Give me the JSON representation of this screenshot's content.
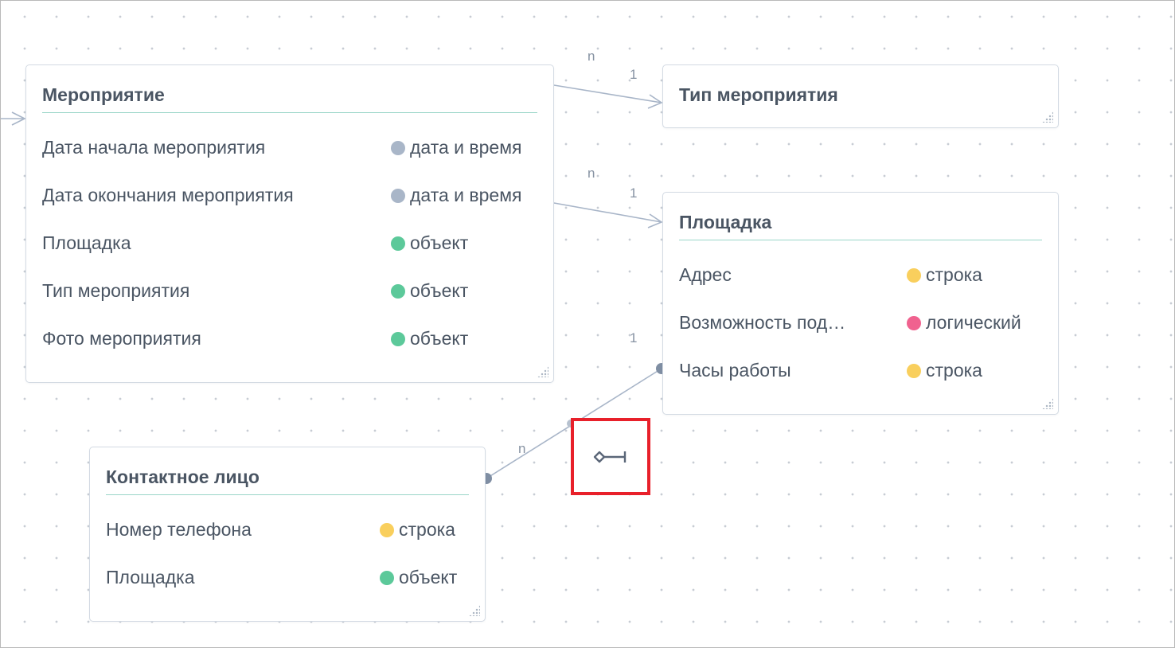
{
  "entities": {
    "event": {
      "title": "Мероприятие",
      "fields": [
        {
          "name": "Дата начала мероприятия",
          "type": "дата и время",
          "color": "#a9b6c8"
        },
        {
          "name": "Дата окончания мероприятия",
          "type": "дата и время",
          "color": "#a9b6c8"
        },
        {
          "name": "Площадка",
          "type": "объект",
          "color": "#5cc99a"
        },
        {
          "name": "Тип мероприятия",
          "type": "объект",
          "color": "#5cc99a"
        },
        {
          "name": "Фото мероприятия",
          "type": "объект",
          "color": "#5cc99a"
        }
      ]
    },
    "event_type": {
      "title": "Тип мероприятия",
      "fields": []
    },
    "venue": {
      "title": "Площадка",
      "fields": [
        {
          "name": "Адрес",
          "type": "строка",
          "color": "#f9cf5d"
        },
        {
          "name": "Возможность под…",
          "type": "логический",
          "color": "#f0628f"
        },
        {
          "name": "Часы работы",
          "type": "строка",
          "color": "#f9cf5d"
        }
      ]
    },
    "contact": {
      "title": "Контактное лицо",
      "fields": [
        {
          "name": "Номер телефона",
          "type": "строка",
          "color": "#f9cf5d"
        },
        {
          "name": "Площадка",
          "type": "объект",
          "color": "#5cc99a"
        }
      ]
    }
  },
  "relations": [
    {
      "from": "Мероприятие",
      "to": "Тип мероприятия",
      "from_card": "n",
      "to_card": "1"
    },
    {
      "from": "Мероприятие",
      "to": "Площадка",
      "from_card": "n",
      "to_card": "1"
    },
    {
      "from": "Контактное лицо",
      "to": "Площадка",
      "from_card": "n",
      "to_card": "1"
    }
  ],
  "toolbar": {
    "icon": "relation-connector-icon",
    "highlight_color": "#e8202a"
  },
  "colors": {
    "line": "#a8b5c8",
    "accent_underline": "#9ad6c8",
    "text": "#4a5563"
  }
}
